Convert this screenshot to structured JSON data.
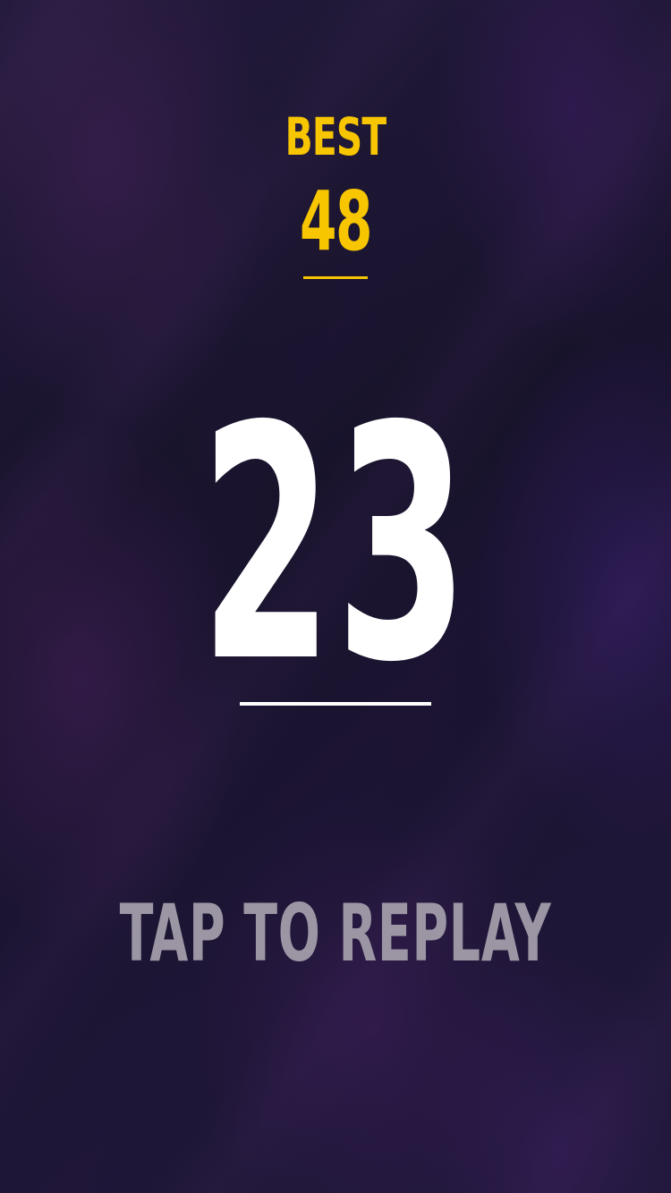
{
  "best": {
    "label": "BEST",
    "value": "48"
  },
  "score": {
    "value": "23"
  },
  "actions": {
    "replay_label": "TAP TO REPLAY"
  },
  "colors": {
    "best": "#f7c600",
    "score": "#ffffff",
    "replay": "#9b95a4",
    "background": "#1b1530"
  }
}
